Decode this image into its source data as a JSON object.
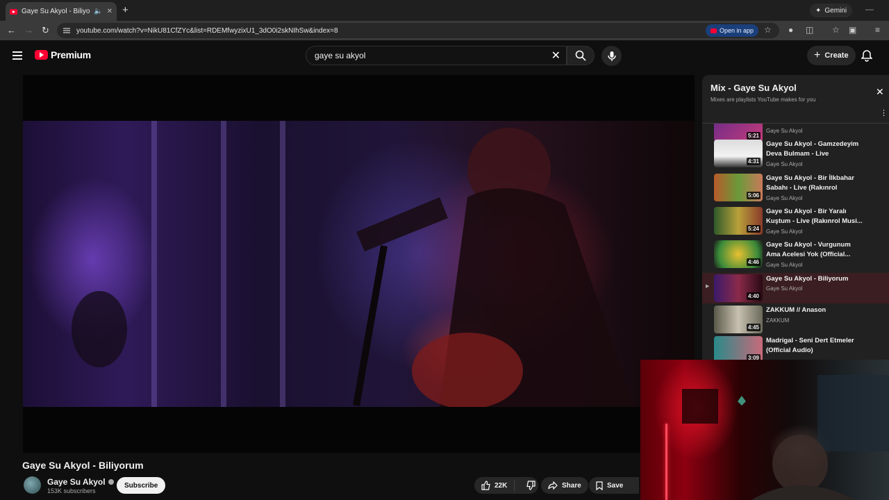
{
  "browser": {
    "tab_title": "Gaye Su Akyol - Biliyorum",
    "new_tab": "+",
    "gemini_label": "Gemini",
    "url": "youtube.com/watch?v=NikU81CfZYc&list=RDEMfwyzixU1_3dO0i2skNIhSw&index=8",
    "open_in_app": "Open in app"
  },
  "header": {
    "logo_text": "Premium",
    "search_value": "gaye su akyol",
    "create_label": "Create"
  },
  "video": {
    "title": "Gaye Su Akyol - Biliyorum",
    "channel": "Gaye Su Akyol",
    "subscribers": "153K subscribers",
    "subscribe_label": "Subscribe",
    "likes": "22K",
    "share_label": "Share",
    "save_label": "Save"
  },
  "playlist": {
    "title": "Mix - Gaye Su Akyol",
    "subtitle": "Mixes are playlists YouTube makes for you",
    "items": [
      {
        "title": "",
        "channel": "Gaye Su Akyol",
        "duration": "5:21"
      },
      {
        "title": "Gaye Su Akyol - Gamzedeyim Deva Bulmam - Live (Rakınrol...",
        "channel": "Gaye Su Akyol",
        "duration": "4:31"
      },
      {
        "title": "Gaye Su Akyol - Bir İlkbahar Sabahı - Live (Rakınrol Musiki...",
        "channel": "Gaye Su Akyol",
        "duration": "5:06"
      },
      {
        "title": "Gaye Su Akyol - Bir Yaralı Kuştum - Live (Rakınrol Musi...",
        "channel": "Gaye Su Akyol",
        "duration": "5:24"
      },
      {
        "title": "Gaye Su Akyol - Vurgunum Ama Acelesi Yok (Official...",
        "channel": "Gaye Su Akyol",
        "duration": "4:46"
      },
      {
        "title": "Gaye Su Akyol - Biliyorum",
        "channel": "Gaye Su Akyol",
        "duration": "4:40"
      },
      {
        "title": "ZAKKUM // Anason",
        "channel": "ZAKKUM",
        "duration": "4:45"
      },
      {
        "title": "Madrigal - Seni Dert Etmeler (Official Audio)",
        "channel": "",
        "duration": "3:09"
      }
    ]
  },
  "colors": {
    "youtube_red": "#ff0033",
    "background": "#0f0f0f",
    "panel": "#212121",
    "active_item": "#3b1e22"
  }
}
